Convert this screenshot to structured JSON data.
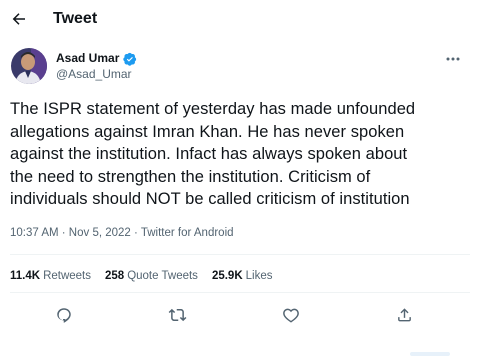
{
  "header": {
    "title": "Tweet",
    "back_icon": "arrow-left-icon"
  },
  "author": {
    "name": "Asad Umar",
    "handle": "@Asad_Umar",
    "verified": true,
    "verified_color": "#1d9bf0"
  },
  "tweet": {
    "text": "The ISPR statement of yesterday has made unfounded\nallegations against Imran Khan. He has never spoken\nagainst the institution. Infact has always spoken about\nthe need to strengthen the institution. Criticism of\nindividuals should NOT be called criticism of institution",
    "meta": "10:37 AM · Nov 5, 2022 · Twitter for Android"
  },
  "stats": {
    "retweets_count": "11.4K",
    "retweets_label": "Retweets",
    "quotes_count": "258",
    "quotes_label": "Quote Tweets",
    "likes_count": "25.9K",
    "likes_label": "Likes"
  },
  "actions": [
    "reply-icon",
    "retweet-icon",
    "like-icon",
    "share-icon"
  ],
  "colors": {
    "text": "#0f1419",
    "muted": "#536471",
    "divider": "#eff3f4",
    "accent": "#1d9bf0"
  }
}
